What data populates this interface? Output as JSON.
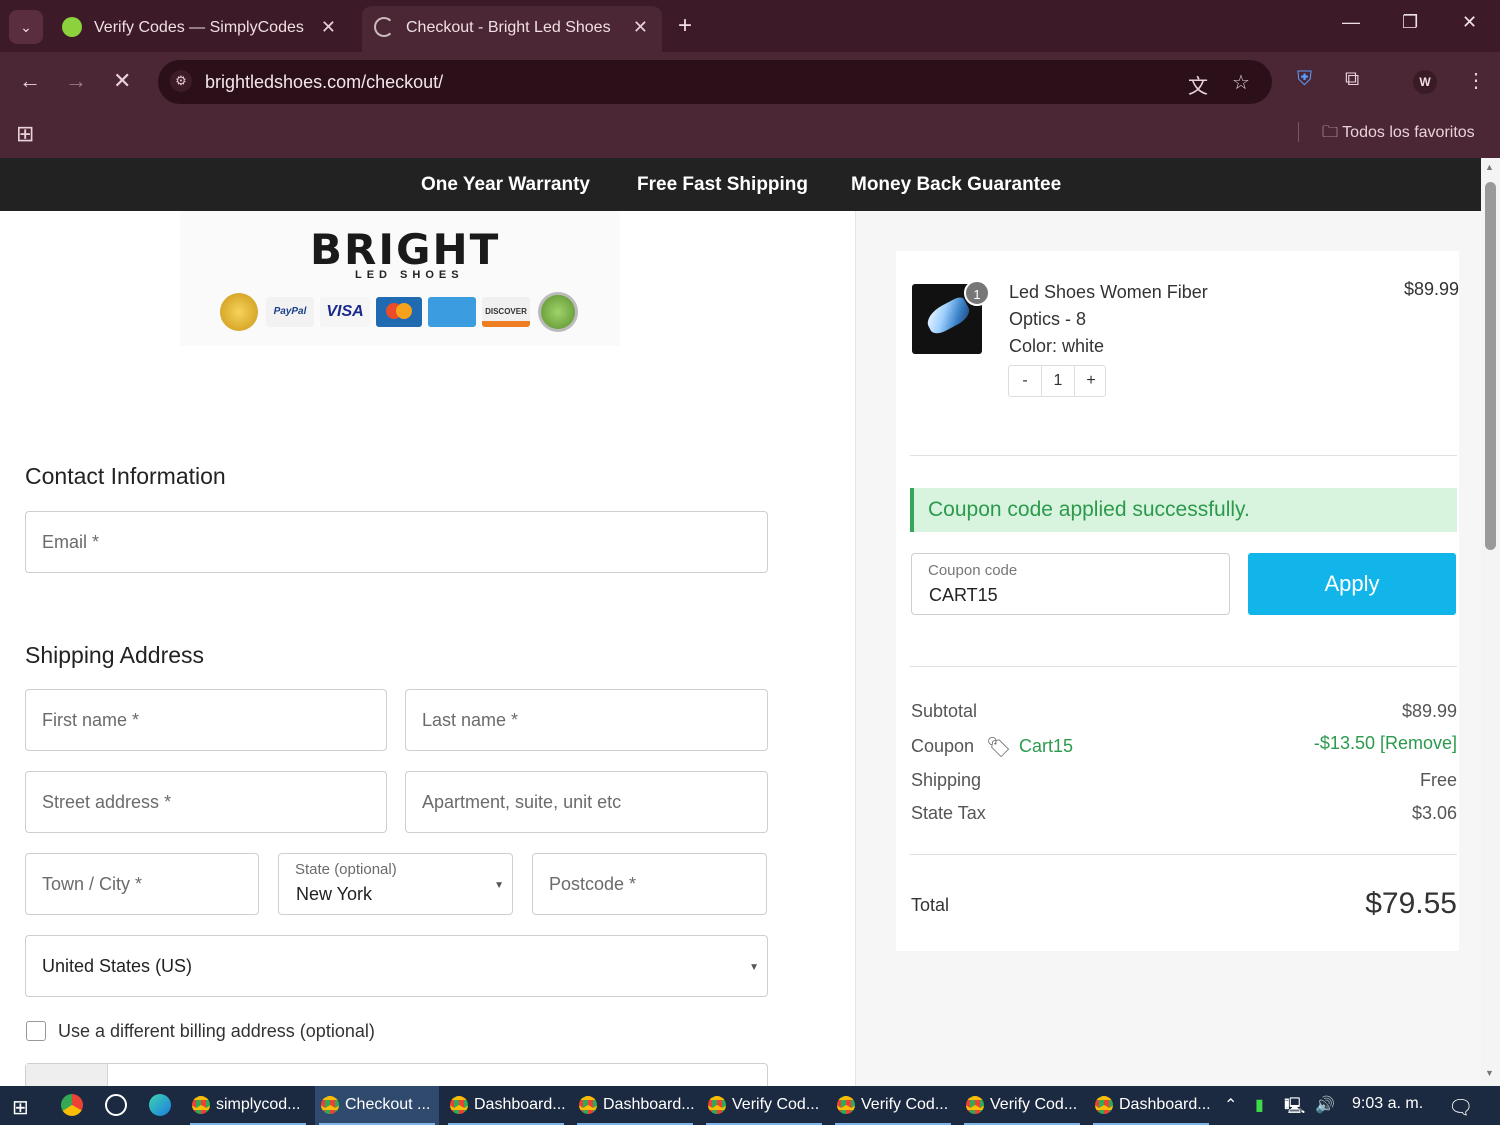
{
  "browser": {
    "tabs": [
      {
        "title": "Verify Codes — SimplyCodes",
        "active": false
      },
      {
        "title": "Checkout - Bright Led Shoes",
        "active": true
      }
    ],
    "url": "brightledshoes.com/checkout/",
    "profile_initial": "W",
    "bookmarks_folder": "Todos los favoritos"
  },
  "topbar": {
    "items": [
      "One Year Warranty",
      "Free Fast Shipping",
      "Money Back Guarantee"
    ]
  },
  "logo": {
    "brand": "BRIGHT",
    "sub": "LED SHOES",
    "payments": [
      "PayPal",
      "VISA",
      "DISCOVER"
    ]
  },
  "contact": {
    "heading": "Contact Information",
    "email_placeholder": "Email *"
  },
  "shipping": {
    "heading": "Shipping Address",
    "first_name": "First name *",
    "last_name": "Last name *",
    "street": "Street address *",
    "apartment": "Apartment, suite, unit etc",
    "city": "Town / City *",
    "state_label": "State (optional)",
    "state_value": "New York",
    "postcode": "Postcode *",
    "country": "United States (US)",
    "billing_checkbox": "Use a different billing address (optional)"
  },
  "cart": {
    "item": {
      "quantity_badge": "1",
      "name_line1": "Led Shoes Women Fiber",
      "name_line2": "Optics - 8",
      "color_line": "Color:  white",
      "price": "$89.99",
      "qty_minus": "-",
      "qty": "1",
      "qty_plus": "+"
    },
    "notice": "Coupon code applied successfully.",
    "coupon_label": "Coupon code",
    "coupon_value": "CART15",
    "apply_label": "Apply",
    "summary": {
      "subtotal_label": "Subtotal",
      "subtotal_value": "$89.99",
      "coupon_label": "Coupon",
      "coupon_code": "Cart15",
      "coupon_value": "-$13.50 [Remove]",
      "shipping_label": "Shipping",
      "shipping_value": "Free",
      "tax_label": "State Tax",
      "tax_value": "$3.06",
      "total_label": "Total",
      "total_value": "$79.55"
    }
  },
  "taskbar": {
    "apps": [
      "simplycod...",
      "Checkout ...",
      "Dashboard...",
      "Dashboard...",
      "Verify Cod...",
      "Verify Cod...",
      "Verify Cod...",
      "Dashboard..."
    ],
    "time": "9:03 a. m."
  },
  "colors": {
    "chrome_bg": "#4b2634",
    "apply_button": "#12b5ea",
    "success_green": "#2c9a4d"
  }
}
